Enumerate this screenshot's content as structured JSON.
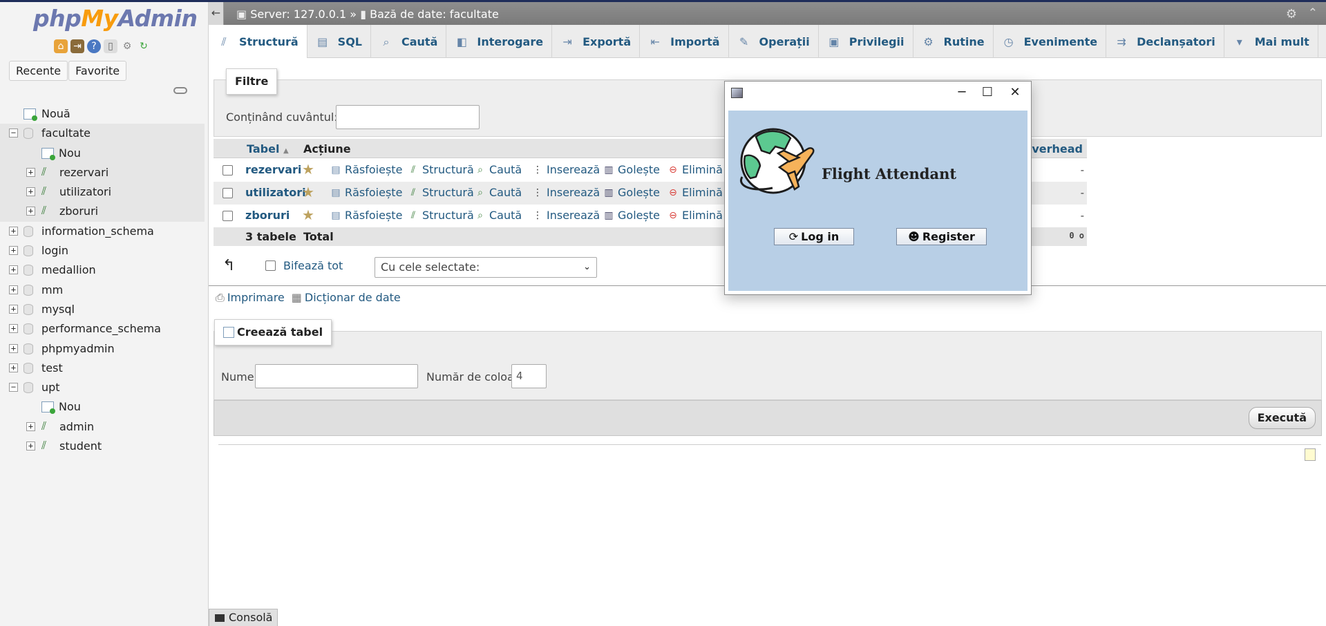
{
  "app": {
    "logo": {
      "part1": "php",
      "part2": "My",
      "part3": "Admin"
    }
  },
  "nav": {
    "tabs": [
      "Recente",
      "Favorite"
    ],
    "tree": [
      {
        "label": "Nouă",
        "type": "new",
        "level": 0
      },
      {
        "label": "facultate",
        "type": "db",
        "level": 0,
        "expanded": true,
        "selected": true
      },
      {
        "label": "Nou",
        "type": "new",
        "level": 1
      },
      {
        "label": "rezervari",
        "type": "table",
        "level": 1
      },
      {
        "label": "utilizatori",
        "type": "table",
        "level": 1
      },
      {
        "label": "zboruri",
        "type": "table",
        "level": 1
      },
      {
        "label": "information_schema",
        "type": "db",
        "level": 0
      },
      {
        "label": "login",
        "type": "db",
        "level": 0
      },
      {
        "label": "medallion",
        "type": "db",
        "level": 0
      },
      {
        "label": "mm",
        "type": "db",
        "level": 0
      },
      {
        "label": "mysql",
        "type": "db",
        "level": 0
      },
      {
        "label": "performance_schema",
        "type": "db",
        "level": 0
      },
      {
        "label": "phpmyadmin",
        "type": "db",
        "level": 0
      },
      {
        "label": "test",
        "type": "db",
        "level": 0
      },
      {
        "label": "upt",
        "type": "db",
        "level": 0,
        "expanded": true
      },
      {
        "label": "Nou",
        "type": "new",
        "level": 1
      },
      {
        "label": "admin",
        "type": "table",
        "level": 1
      },
      {
        "label": "student",
        "type": "table",
        "level": 1
      }
    ]
  },
  "breadcrumb": {
    "server": "Server: 127.0.0.1 »",
    "db": "Bază de date: facultate"
  },
  "tabs": [
    {
      "label": "Structură",
      "icon": "structure-icon",
      "glyph": "⫽"
    },
    {
      "label": "SQL",
      "icon": "sql-icon",
      "glyph": "▤"
    },
    {
      "label": "Caută",
      "icon": "search-icon",
      "glyph": "⌕"
    },
    {
      "label": "Interogare",
      "icon": "query-icon",
      "glyph": "◧"
    },
    {
      "label": "Exportă",
      "icon": "export-icon",
      "glyph": "⇥"
    },
    {
      "label": "Importă",
      "icon": "import-icon",
      "glyph": "⇤"
    },
    {
      "label": "Operații",
      "icon": "wrench-icon",
      "glyph": "✎"
    },
    {
      "label": "Privilegii",
      "icon": "privileges-icon",
      "glyph": "▣"
    },
    {
      "label": "Rutine",
      "icon": "routines-icon",
      "glyph": "⚙"
    },
    {
      "label": "Evenimente",
      "icon": "clock-icon",
      "glyph": "◷"
    },
    {
      "label": "Declanșatori",
      "icon": "triggers-icon",
      "glyph": "⇉"
    },
    {
      "label": "Mai mult",
      "icon": "chevron-down-icon",
      "glyph": "▾"
    }
  ],
  "filters": {
    "legend": "Filtre",
    "label": "Conținând cuvântul:",
    "value": ""
  },
  "table": {
    "headers": {
      "tabel": "Tabel",
      "actiune": "Acțiune",
      "overhead": "Overhead"
    },
    "actions": [
      "Răsfoiește",
      "Structură",
      "Caută",
      "Inserează",
      "Golește",
      "Elimină"
    ],
    "rows": [
      {
        "name": "rezervari",
        "overhead": "-"
      },
      {
        "name": "utilizatori",
        "overhead": "-"
      },
      {
        "name": "zboruri",
        "overhead": "-"
      }
    ],
    "total": {
      "count": "3 tabele",
      "label": "Total",
      "overhead": "0 o"
    }
  },
  "selection": {
    "check_all": "Bifează tot",
    "with_selected": "Cu cele selectate:"
  },
  "links": {
    "print": "Imprimare",
    "dictionary": "Dicționar de date"
  },
  "create_table": {
    "legend": "Creează tabel",
    "name_label": "Nume:",
    "name_value": "",
    "cols_label": "Număr de coloane:",
    "cols_value": "4",
    "go": "Execută"
  },
  "console": {
    "label": "Consolă"
  },
  "dialog": {
    "title": "Flight Attendant",
    "login": "Log in",
    "register": "Register",
    "colors": {
      "body": "#b8cfe6"
    }
  }
}
